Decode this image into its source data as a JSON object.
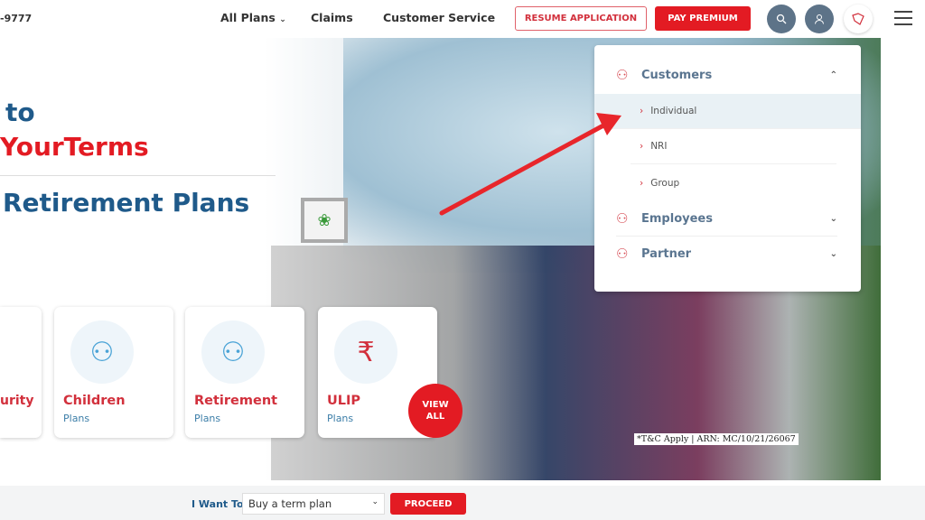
{
  "header": {
    "phone": "-9777",
    "nav": [
      "All Plans",
      "Claims",
      "Customer Service"
    ],
    "resume_label": "RESUME APPLICATION",
    "pay_label": "PAY PREMIUM",
    "icons": [
      "search-icon",
      "user-icon",
      "brand-logo-icon",
      "hamburger-menu-icon"
    ]
  },
  "hero": {
    "line1": "to",
    "line2": "YourTerms",
    "line3": "Retirement Plans",
    "tc": "*T&C Apply | ARN: MC/10/21/26067"
  },
  "cards": [
    {
      "title": "urity",
      "sub": ""
    },
    {
      "title": "Children",
      "sub": "Plans"
    },
    {
      "title": "Retirement",
      "sub": "Plans"
    },
    {
      "title": "ULIP",
      "sub": "Plans"
    }
  ],
  "view_all": [
    "VIEW",
    "ALL"
  ],
  "menu": {
    "customers": "Customers",
    "items": [
      "Individual",
      "NRI",
      "Group"
    ],
    "employees": "Employees",
    "partner": "Partner"
  },
  "bottom": {
    "label": "I Want To",
    "select": "Buy a term plan",
    "proceed": "PROCEED"
  },
  "colors": {
    "brand_red": "#e31b23",
    "brand_blue": "#1f5a8a",
    "arrow": "#e8262b"
  }
}
